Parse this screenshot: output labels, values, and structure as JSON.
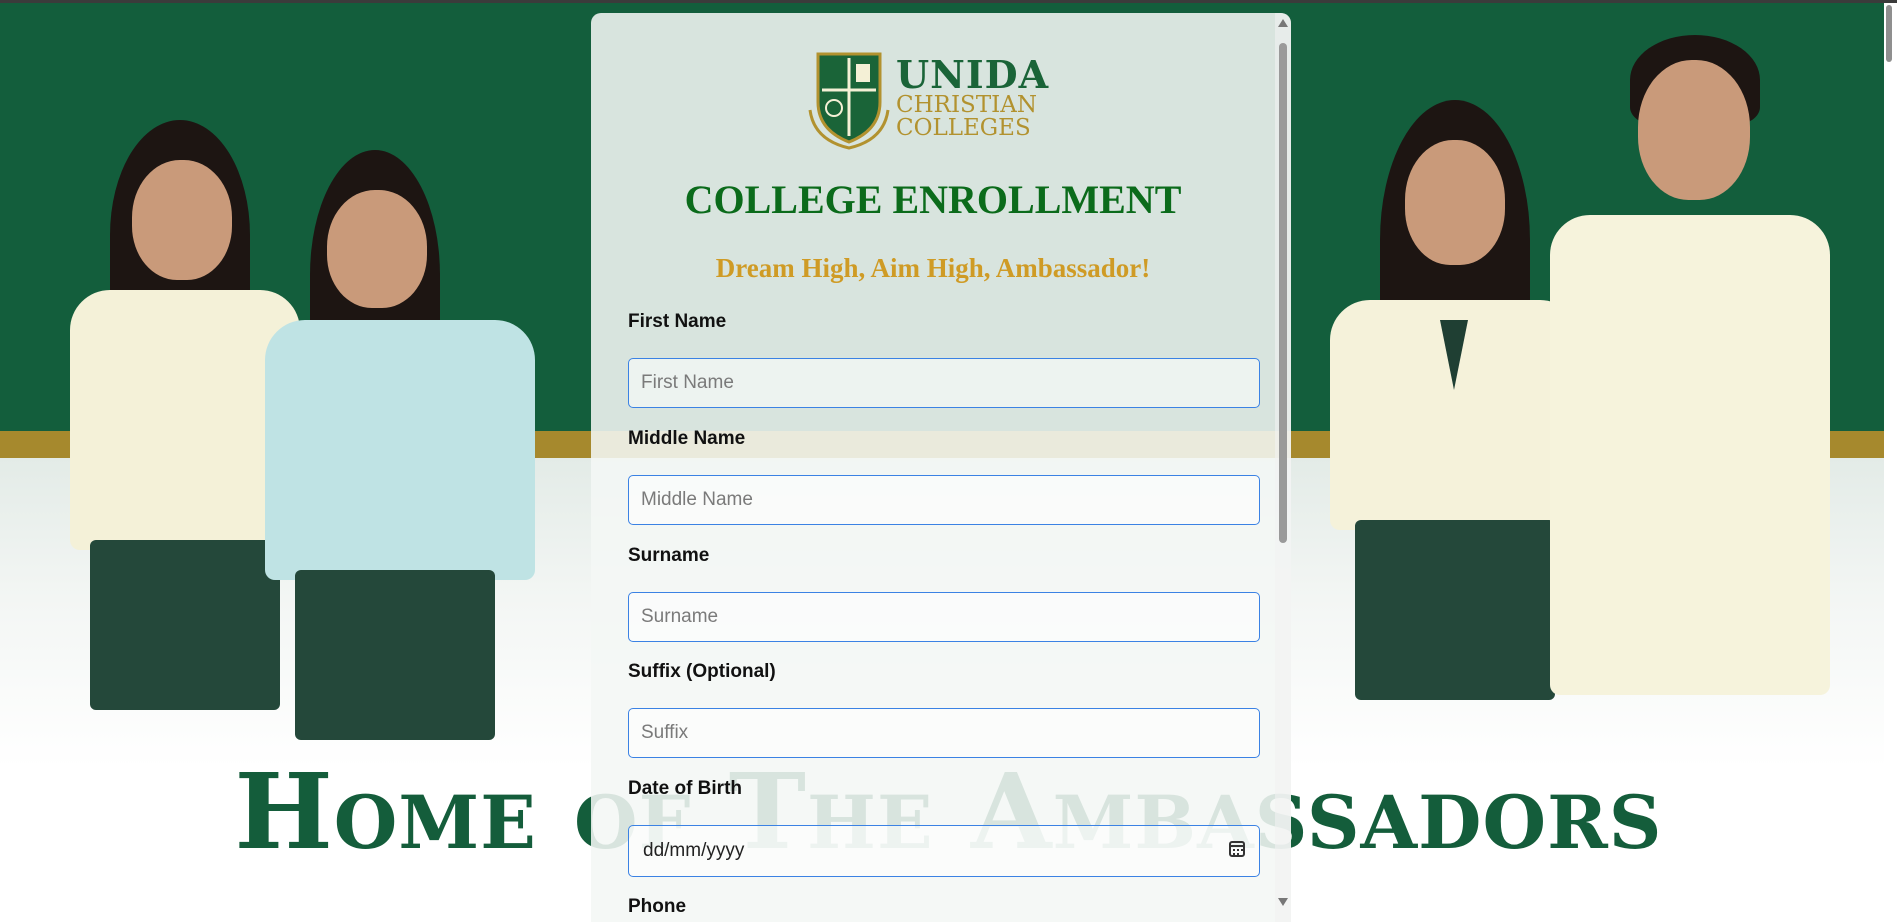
{
  "hero": {
    "headline": "Home of The Ambassadors",
    "watermark_line1": "UNIDA",
    "watermark_line2": "CHRISTIAN",
    "watermark_line3": "COLLEGES"
  },
  "form": {
    "logo": {
      "line1": "UNIDA",
      "line2": "CHRISTIAN",
      "line3": "COLLEGES"
    },
    "title": "COLLEGE ENROLLMENT",
    "tagline": "Dream High, Aim High, Ambassador!",
    "fields": [
      {
        "label": "First Name",
        "placeholder": "First Name"
      },
      {
        "label": "Middle Name",
        "placeholder": "Middle Name"
      },
      {
        "label": "Surname",
        "placeholder": "Surname"
      },
      {
        "label": "Suffix (Optional)",
        "placeholder": "Suffix"
      }
    ],
    "dob": {
      "label": "Date of Birth",
      "value": "dd/mm/yyyy"
    },
    "phone_label": "Phone"
  },
  "colors": {
    "brand_green": "#135e3c",
    "gold": "#a6892d",
    "title_green": "#0b6b1b",
    "tagline_gold": "#cf9b25",
    "input_border": "#3b82e4"
  },
  "icons": [
    "calendar-icon",
    "scroll-up-icon",
    "scroll-down-icon",
    "crest-icon"
  ]
}
